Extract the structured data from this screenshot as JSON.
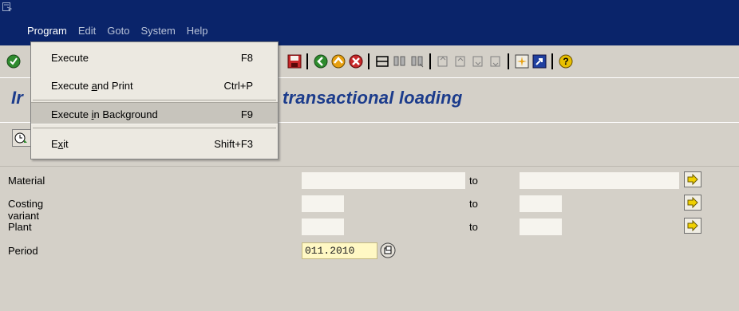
{
  "menubar": {
    "items": [
      {
        "label": "Program"
      },
      {
        "label": "Edit"
      },
      {
        "label": "Goto"
      },
      {
        "label": "System"
      },
      {
        "label": "Help"
      }
    ]
  },
  "dropdown": {
    "items": [
      {
        "label_pre": "Execute",
        "label_ul": "",
        "label_post": "",
        "shortcut": "F8"
      },
      {
        "label_pre": "Execute ",
        "label_ul": "a",
        "label_post": "nd Print",
        "shortcut": "Ctrl+P"
      },
      {
        "label_pre": "Execute ",
        "label_ul": "i",
        "label_post": "n Background",
        "shortcut": "F9"
      },
      {
        "label_pre": "E",
        "label_ul": "x",
        "label_post": "it",
        "shortcut": "Shift+F3"
      }
    ]
  },
  "page": {
    "title_left": "Ir",
    "title_right": "transactional loading"
  },
  "form": {
    "to_label": "to",
    "rows": [
      {
        "label": "Material"
      },
      {
        "label": "Costing variant"
      },
      {
        "label": "Plant"
      },
      {
        "label": "Period",
        "value": "011.2010"
      }
    ]
  },
  "colors": {
    "titlebar": "#0a246a",
    "title_text": "#1c3c8c",
    "period_bg": "#fff8c4"
  }
}
